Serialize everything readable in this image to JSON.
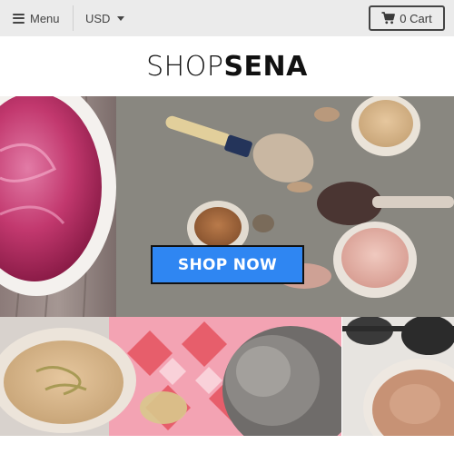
{
  "topbar": {
    "menu_label": "Menu",
    "currency_label": "USD",
    "cart_label": "0 Cart",
    "icons": [
      "hamburger-icon",
      "chevron-down-icon",
      "cart-icon"
    ]
  },
  "header": {
    "logo_light": "SHOP",
    "logo_bold": "SENA"
  },
  "hero": {
    "cta_label": "SHOP NOW",
    "cta_color": "#2f86f2"
  },
  "colors": {
    "topbar_bg": "#ebebeb",
    "text_dark": "#444444",
    "brand_text": "#111111"
  }
}
